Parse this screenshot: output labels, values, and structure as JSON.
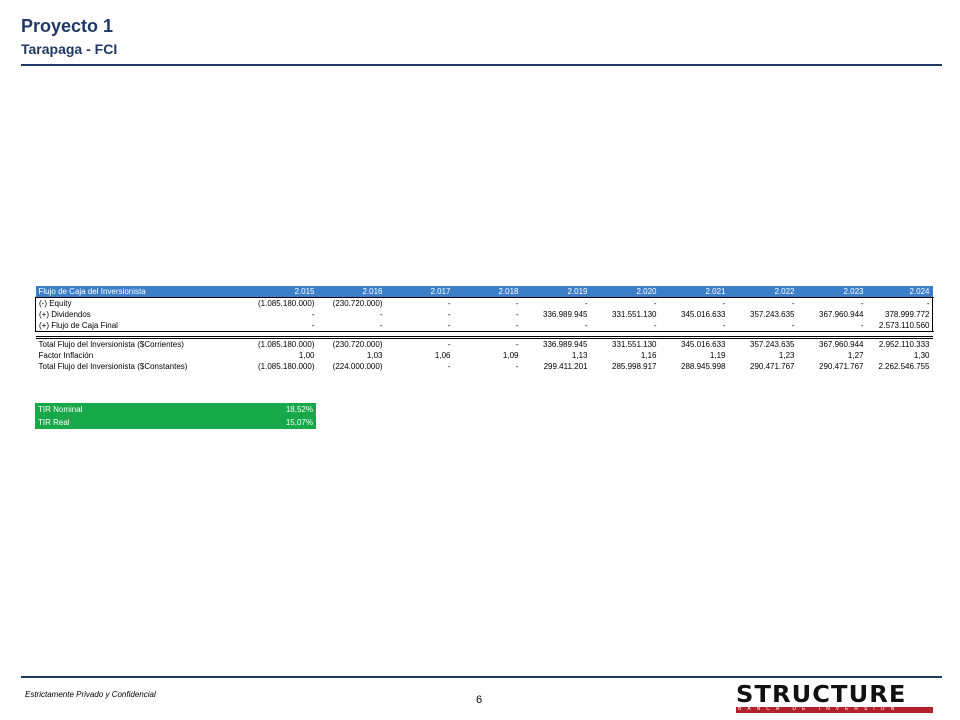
{
  "header": {
    "title": "Proyecto 1",
    "subtitle": "Tarapaga - FCI"
  },
  "cashflow": {
    "header": {
      "label": "Flujo de Caja del Inversionista",
      "years": [
        "2.015",
        "2.016",
        "2.017",
        "2.018",
        "2.019",
        "2.020",
        "2.021",
        "2.022",
        "2.023",
        "2.024"
      ]
    },
    "rows": [
      {
        "label": "(-) Equity",
        "values": [
          "(1.085.180.000)",
          "(230.720.000)",
          "-",
          "-",
          "-",
          "-",
          "-",
          "-",
          "-",
          "-"
        ]
      },
      {
        "label": "(+) Dividendos",
        "values": [
          "-",
          "-",
          "-",
          "-",
          "336.989.945",
          "331.551.130",
          "345.016.633",
          "357.243.635",
          "367.960.944",
          "378.999.772"
        ]
      },
      {
        "label": "(+) Flujo de Caja Final",
        "values": [
          "-",
          "-",
          "-",
          "-",
          "-",
          "-",
          "-",
          "-",
          "-",
          "2.573.110.560"
        ]
      }
    ],
    "totals": [
      {
        "label": "Total Flujo del Inversionista ($Corrientes)",
        "values": [
          "(1.085.180.000)",
          "(230.720.000)",
          "-",
          "-",
          "336.989.945",
          "331.551.130",
          "345.016.633",
          "357.243.635",
          "367.960.944",
          "2.952.110.333"
        ]
      },
      {
        "label": "Factor Inflación",
        "values": [
          "1,00",
          "1,03",
          "1,06",
          "1,09",
          "1,13",
          "1,16",
          "1,19",
          "1,23",
          "1,27",
          "1,30"
        ]
      },
      {
        "label": "Total Flujo del Inversionista ($Constantes)",
        "values": [
          "(1.085.180.000)",
          "(224.000.000)",
          "-",
          "-",
          "299.411.201",
          "285.998.917",
          "288.945.998",
          "290.471.767",
          "290.471.767",
          "2.262.546.755"
        ]
      }
    ]
  },
  "tir": {
    "nominal_label": "TIR Nominal",
    "nominal_value": "18,52%",
    "real_label": "TIR Real",
    "real_value": "15,07%"
  },
  "footer": {
    "confidential": "Estrictamente Privado y Confidencial",
    "page_number": "6",
    "logo_text": "STRUCTURE",
    "logo_subtext": "BANCA DE INVERSION"
  },
  "colors": {
    "title": "#1f3864",
    "table_header": "#3c7fc8",
    "tir_box": "#17a84a",
    "logo_band": "#b3202c"
  }
}
